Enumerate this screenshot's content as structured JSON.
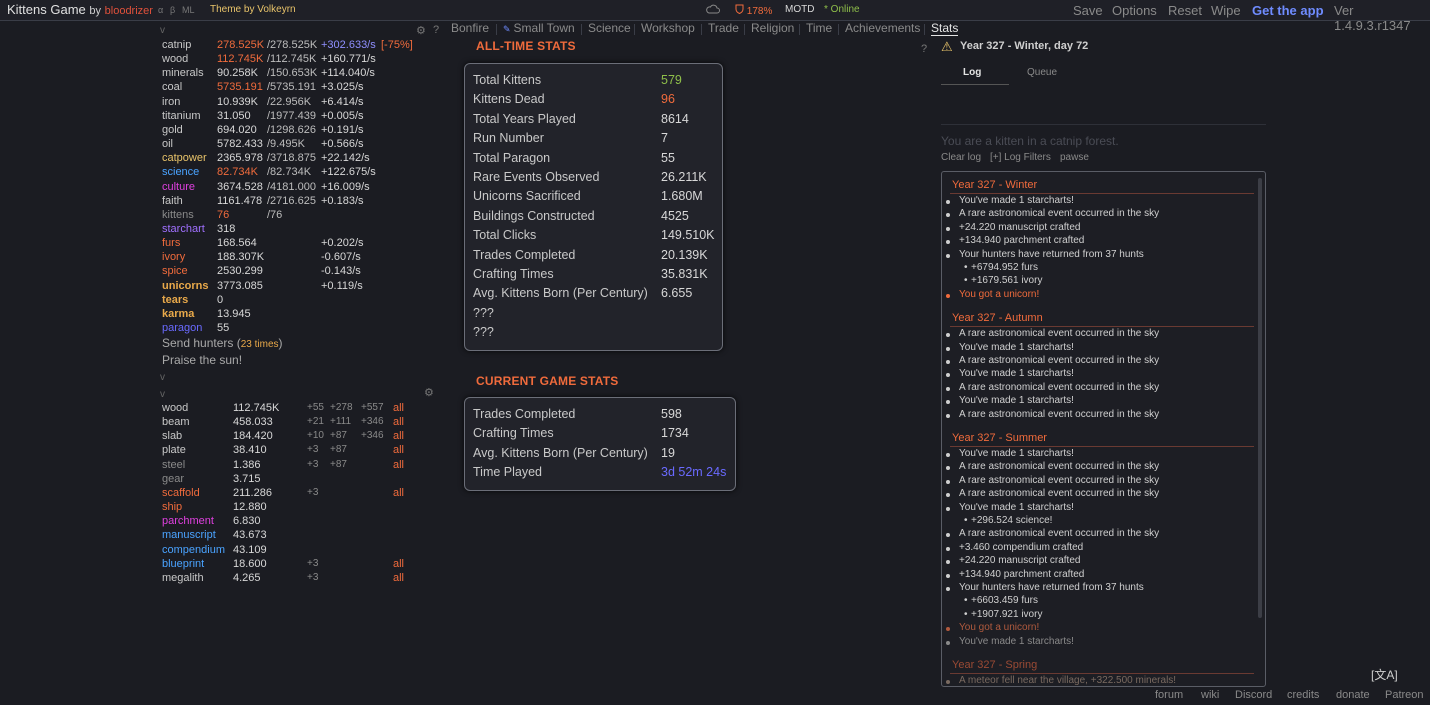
{
  "topbar": {
    "game_title": "Kittens Game",
    "by": "by",
    "author": "bloodrizer",
    "tiny_labels": [
      "α",
      "β",
      "ML"
    ],
    "theme_prefix": "Theme by",
    "theme_author": "Volkeyrn",
    "happiness": "178%",
    "motd": "MOTD",
    "online": "* Online",
    "menu": [
      "Save",
      "Options",
      "Reset",
      "Wipe"
    ],
    "get_app": "Get the app",
    "version": "Ver 1.4.9.3.r1347"
  },
  "tabs": [
    "Bonfire",
    "Small Town",
    "Science",
    "Workshop",
    "Trade",
    "Religion",
    "Time",
    "Achievements",
    "Stats"
  ],
  "active_tab": "Stats",
  "resources": [
    {
      "name": "catnip",
      "amount": "278.525K",
      "max": "/278.525K",
      "rate": "+302.633/s",
      "extra": "[-75%]",
      "name_color": "#c8c8c8",
      "amount_color": "#f06b3c",
      "rate_color": "#8f8fff"
    },
    {
      "name": "wood",
      "amount": "112.745K",
      "max": "/112.745K",
      "rate": "+160.771/s",
      "extra": "",
      "name_color": "#c8c8c8",
      "amount_color": "#f06b3c",
      "rate_color": "#d8d8d8"
    },
    {
      "name": "minerals",
      "amount": "90.258K",
      "max": "/150.653K",
      "rate": "+114.040/s",
      "extra": "",
      "name_color": "#c8c8c8",
      "amount_color": "#d8d8d8",
      "rate_color": "#d8d8d8"
    },
    {
      "name": "coal",
      "amount": "5735.191",
      "max": "/5735.191",
      "rate": "+3.025/s",
      "extra": "",
      "name_color": "#c8c8c8",
      "amount_color": "#f06b3c",
      "rate_color": "#d8d8d8"
    },
    {
      "name": "iron",
      "amount": "10.939K",
      "max": "/22.956K",
      "rate": "+6.414/s",
      "extra": "",
      "name_color": "#c8c8c8",
      "amount_color": "#d8d8d8",
      "rate_color": "#d8d8d8"
    },
    {
      "name": "titanium",
      "amount": "31.050",
      "max": "/1977.439",
      "rate": "+0.005/s",
      "extra": "",
      "name_color": "#c8c8c8",
      "amount_color": "#d8d8d8",
      "rate_color": "#d8d8d8"
    },
    {
      "name": "gold",
      "amount": "694.020",
      "max": "/1298.626",
      "rate": "+0.191/s",
      "extra": "",
      "name_color": "#c8c8c8",
      "amount_color": "#d8d8d8",
      "rate_color": "#d8d8d8"
    },
    {
      "name": "oil",
      "amount": "5782.433",
      "max": "/9.495K",
      "rate": "+0.566/s",
      "extra": "",
      "name_color": "#c8c8c8",
      "amount_color": "#d8d8d8",
      "rate_color": "#d8d8d8"
    },
    {
      "name": "catpower",
      "amount": "2365.978",
      "max": "/3718.875",
      "rate": "+22.142/s",
      "extra": "",
      "name_color": "#e9c46a",
      "amount_color": "#d8d8d8",
      "rate_color": "#d8d8d8"
    },
    {
      "name": "science",
      "amount": "82.734K",
      "max": "/82.734K",
      "rate": "+122.675/s",
      "extra": "",
      "name_color": "#4aa3ff",
      "amount_color": "#f06b3c",
      "rate_color": "#d8d8d8"
    },
    {
      "name": "culture",
      "amount": "3674.528",
      "max": "/4181.000",
      "rate": "+16.009/s",
      "extra": "",
      "name_color": "#e040e0",
      "amount_color": "#d8d8d8",
      "rate_color": "#d8d8d8"
    },
    {
      "name": "faith",
      "amount": "1161.478",
      "max": "/2716.625",
      "rate": "+0.183/s",
      "extra": "",
      "name_color": "#c8c8c8",
      "amount_color": "#d8d8d8",
      "rate_color": "#d8d8d8"
    },
    {
      "name": "kittens",
      "amount": "76",
      "max": "/76",
      "rate": "",
      "extra": "",
      "name_color": "#8a8a8a",
      "amount_color": "#f06b3c",
      "rate_color": "#d8d8d8"
    },
    {
      "name": "starchart",
      "amount": "318",
      "max": "",
      "rate": "",
      "extra": "",
      "name_color": "#a070ff",
      "amount_color": "#d8d8d8",
      "rate_color": "#d8d8d8"
    },
    {
      "name": "furs",
      "amount": "168.564",
      "max": "",
      "rate": "+0.202/s",
      "extra": "",
      "name_color": "#f06b3c",
      "amount_color": "#d8d8d8",
      "rate_color": "#d8d8d8"
    },
    {
      "name": "ivory",
      "amount": "188.307K",
      "max": "",
      "rate": "-0.607/s",
      "extra": "",
      "name_color": "#f06b3c",
      "amount_color": "#d8d8d8",
      "rate_color": "#d8d8d8"
    },
    {
      "name": "spice",
      "amount": "2530.299",
      "max": "",
      "rate": "-0.143/s",
      "extra": "",
      "name_color": "#f06b3c",
      "amount_color": "#d8d8d8",
      "rate_color": "#d8d8d8"
    },
    {
      "name": "unicorns",
      "amount": "3773.085",
      "max": "",
      "rate": "+0.119/s",
      "extra": "",
      "name_color": "#e9a94a",
      "amount_color": "#d8d8d8",
      "rate_color": "#d8d8d8",
      "name_bold": true
    },
    {
      "name": "tears",
      "amount": "0",
      "max": "",
      "rate": "",
      "extra": "",
      "name_color": "#e9a94a",
      "amount_color": "#d8d8d8",
      "rate_color": "#d8d8d8",
      "name_bold": true
    },
    {
      "name": "karma",
      "amount": "13.945",
      "max": "",
      "rate": "",
      "extra": "",
      "name_color": "#e9a94a",
      "amount_color": "#d8d8d8",
      "rate_color": "#d8d8d8",
      "name_bold": true
    },
    {
      "name": "paragon",
      "amount": "55",
      "max": "",
      "rate": "",
      "extra": "",
      "name_color": "#6a6aff",
      "amount_color": "#d8d8d8",
      "rate_color": "#d8d8d8"
    }
  ],
  "send_hunters": {
    "label": "Send hunters (",
    "count": "23 times",
    "close": ")"
  },
  "praise": "Praise the sun!",
  "crafts": [
    {
      "name": "wood",
      "amount": "112.745K",
      "b1": "+55",
      "b2": "+278",
      "b3": "+557",
      "all": "all",
      "name_color": "#c8c8c8"
    },
    {
      "name": "beam",
      "amount": "458.033",
      "b1": "+21",
      "b2": "+111",
      "b3": "+346",
      "all": "all",
      "name_color": "#c8c8c8"
    },
    {
      "name": "slab",
      "amount": "184.420",
      "b1": "+10",
      "b2": "+87",
      "b3": "+346",
      "all": "all",
      "name_color": "#c8c8c8"
    },
    {
      "name": "plate",
      "amount": "38.410",
      "b1": "+3",
      "b2": "+87",
      "b3": "",
      "all": "all",
      "name_color": "#c8c8c8"
    },
    {
      "name": "steel",
      "amount": "1.386",
      "b1": "+3",
      "b2": "+87",
      "b3": "",
      "all": "all",
      "name_color": "#8a8a8a"
    },
    {
      "name": "gear",
      "amount": "3.715",
      "b1": "",
      "b2": "",
      "b3": "",
      "all": "",
      "name_color": "#8a8a8a"
    },
    {
      "name": "scaffold",
      "amount": "211.286",
      "b1": "+3",
      "b2": "",
      "b3": "",
      "all": "all",
      "name_color": "#f06b3c"
    },
    {
      "name": "ship",
      "amount": "12.880",
      "b1": "",
      "b2": "",
      "b3": "",
      "all": "",
      "name_color": "#f06b3c"
    },
    {
      "name": "parchment",
      "amount": "6.830",
      "b1": "",
      "b2": "",
      "b3": "",
      "all": "",
      "name_color": "#e040e0"
    },
    {
      "name": "manuscript",
      "amount": "43.673",
      "b1": "",
      "b2": "",
      "b3": "",
      "all": "",
      "name_color": "#4aa3ff"
    },
    {
      "name": "compendium",
      "amount": "43.109",
      "b1": "",
      "b2": "",
      "b3": "",
      "all": "",
      "name_color": "#4aa3ff"
    },
    {
      "name": "blueprint",
      "amount": "18.600",
      "b1": "+3",
      "b2": "",
      "b3": "",
      "all": "all",
      "name_color": "#4aa3ff"
    },
    {
      "name": "megalith",
      "amount": "4.265",
      "b1": "+3",
      "b2": "",
      "b3": "",
      "all": "all",
      "name_color": "#c8c8c8"
    }
  ],
  "all_time": {
    "title": "ALL-TIME STATS",
    "rows": [
      {
        "label": "Total Kittens",
        "value": "579",
        "color": "#8fbf4a"
      },
      {
        "label": "Kittens Dead",
        "value": "96",
        "color": "#f06b3c"
      },
      {
        "label": "Total Years Played",
        "value": "8614",
        "color": "#d8d8d8"
      },
      {
        "label": "Run Number",
        "value": "7",
        "color": "#d8d8d8"
      },
      {
        "label": "Total Paragon",
        "value": "55",
        "color": "#d8d8d8"
      },
      {
        "label": "Rare Events Observed",
        "value": "26.211K",
        "color": "#d8d8d8"
      },
      {
        "label": "Unicorns Sacrificed",
        "value": "1.680M",
        "color": "#d8d8d8"
      },
      {
        "label": "Buildings Constructed",
        "value": "4525",
        "color": "#d8d8d8"
      },
      {
        "label": "Total Clicks",
        "value": "149.510K",
        "color": "#d8d8d8"
      },
      {
        "label": "Trades Completed",
        "value": "20.139K",
        "color": "#d8d8d8"
      },
      {
        "label": "Crafting Times",
        "value": "35.831K",
        "color": "#d8d8d8"
      },
      {
        "label": "Avg. Kittens Born (Per Century)",
        "value": "6.655",
        "color": "#d8d8d8"
      },
      {
        "label": "???",
        "value": "",
        "color": "#d8d8d8"
      },
      {
        "label": "???",
        "value": "",
        "color": "#d8d8d8"
      }
    ]
  },
  "current": {
    "title": "CURRENT GAME STATS",
    "rows": [
      {
        "label": "Trades Completed",
        "value": "598",
        "color": "#d8d8d8"
      },
      {
        "label": "Crafting Times",
        "value": "1734",
        "color": "#d8d8d8"
      },
      {
        "label": "Avg. Kittens Born (Per Century)",
        "value": "19",
        "color": "#d8d8d8"
      },
      {
        "label": "Time Played",
        "value": "3d 52m 24s",
        "color": "#6a6aff"
      }
    ]
  },
  "right": {
    "date": "Year 327 - Winter, day 72",
    "log_tab": "Log",
    "queue_tab": "Queue",
    "flavor": "You are a kitten in a catnip forest.",
    "clear_log": "Clear log",
    "log_filters": "[+] Log Filters",
    "pawse": "pawse"
  },
  "log": [
    {
      "season": "Year 327 - Winter",
      "lines": [
        {
          "t": "You've made 1 starcharts!",
          "c": "#d0d0d0",
          "indent": false
        },
        {
          "t": "A rare astronomical event occurred in the sky",
          "c": "#d0d0d0",
          "indent": false
        },
        {
          "t": "+24.220 manuscript crafted",
          "c": "#d0d0d0",
          "indent": false
        },
        {
          "t": "+134.940 parchment crafted",
          "c": "#d0d0d0",
          "indent": false
        },
        {
          "t": "Your hunters have returned from 37 hunts",
          "c": "#d0d0d0",
          "indent": false
        },
        {
          "t": "+6794.952 furs",
          "c": "#d0d0d0",
          "indent": true
        },
        {
          "t": "+1679.561 ivory",
          "c": "#d0d0d0",
          "indent": true
        },
        {
          "t": "You got a unicorn!",
          "c": "#f06b3c",
          "indent": false
        }
      ]
    },
    {
      "season": "Year 327 - Autumn",
      "lines": [
        {
          "t": "A rare astronomical event occurred in the sky",
          "c": "#d0d0d0",
          "indent": false
        },
        {
          "t": "You've made 1 starcharts!",
          "c": "#d0d0d0",
          "indent": false
        },
        {
          "t": "A rare astronomical event occurred in the sky",
          "c": "#d0d0d0",
          "indent": false
        },
        {
          "t": "You've made 1 starcharts!",
          "c": "#d0d0d0",
          "indent": false
        },
        {
          "t": "A rare astronomical event occurred in the sky",
          "c": "#d0d0d0",
          "indent": false
        },
        {
          "t": "You've made 1 starcharts!",
          "c": "#d0d0d0",
          "indent": false
        },
        {
          "t": "A rare astronomical event occurred in the sky",
          "c": "#d0d0d0",
          "indent": false
        }
      ]
    },
    {
      "season": "Year 327 - Summer",
      "lines": [
        {
          "t": "You've made 1 starcharts!",
          "c": "#d0d0d0",
          "indent": false
        },
        {
          "t": "A rare astronomical event occurred in the sky",
          "c": "#d0d0d0",
          "indent": false
        },
        {
          "t": "A rare astronomical event occurred in the sky",
          "c": "#d0d0d0",
          "indent": false
        },
        {
          "t": "A rare astronomical event occurred in the sky",
          "c": "#d0d0d0",
          "indent": false
        },
        {
          "t": "You've made 1 starcharts!",
          "c": "#d0d0d0",
          "indent": false
        },
        {
          "t": "+296.524 science!",
          "c": "#d0d0d0",
          "indent": true
        },
        {
          "t": "A rare astronomical event occurred in the sky",
          "c": "#d0d0d0",
          "indent": false
        },
        {
          "t": "+3.460 compendium crafted",
          "c": "#d0d0d0",
          "indent": false
        },
        {
          "t": "+24.220 manuscript crafted",
          "c": "#d0d0d0",
          "indent": false
        },
        {
          "t": "+134.940 parchment crafted",
          "c": "#d0d0d0",
          "indent": false
        },
        {
          "t": "Your hunters have returned from 37 hunts",
          "c": "#d0d0d0",
          "indent": false
        },
        {
          "t": "+6603.459 furs",
          "c": "#d0d0d0",
          "indent": true
        },
        {
          "t": "+1907.921 ivory",
          "c": "#d0d0d0",
          "indent": true
        },
        {
          "t": "You got a unicorn!",
          "c": "#b05a3e",
          "indent": false
        },
        {
          "t": "You've made 1 starcharts!",
          "c": "#8a8a8a",
          "indent": false
        }
      ]
    },
    {
      "season": "Year 327 - Spring",
      "dim": true,
      "lines": [
        {
          "t": "A meteor fell near the village, +322.500 minerals!",
          "c": "#7a6a60",
          "indent": false
        }
      ]
    }
  ],
  "footer": [
    "forum",
    "wiki",
    "Discord",
    "credits",
    "donate",
    "Patreon"
  ],
  "lang_icon": "[文A]"
}
